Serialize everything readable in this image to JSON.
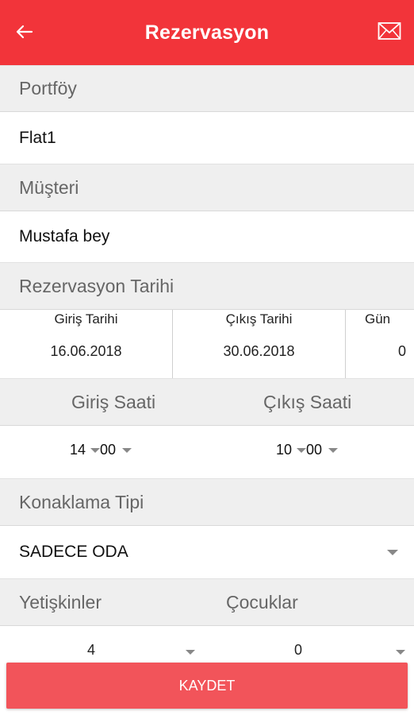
{
  "appbar": {
    "title": "Rezervasyon",
    "back_icon": "arrow-left-icon",
    "mail_icon": "envelope-icon",
    "color": "#f2343a"
  },
  "portfolio": {
    "header": "Portföy",
    "value": "Flat1"
  },
  "customer": {
    "header": "Müşteri",
    "value": "Mustafa bey"
  },
  "reservation_date": {
    "header": "Rezervasyon Tarihi",
    "checkin_label": "Giriş Tarihi",
    "checkin_value": "16.06.2018",
    "checkout_label": "Çıkış Tarihi",
    "checkout_value": "30.06.2018",
    "days_label": "Gün",
    "days_value": "0"
  },
  "times": {
    "checkin_label": "Giriş Saati",
    "checkout_label": "Çıkış Saati",
    "checkin_hour": "14",
    "checkin_minute": "00",
    "checkout_hour": "10",
    "checkout_minute": "00"
  },
  "accommodation": {
    "header": "Konaklama Tipi",
    "selected": "SADECE ODA"
  },
  "guests": {
    "adults_label": "Yetişkinler",
    "children_label": "Çocuklar",
    "adults_value": "4",
    "children_value": "0"
  },
  "save_button": {
    "label": "KAYDET",
    "color": "#f2545a"
  }
}
